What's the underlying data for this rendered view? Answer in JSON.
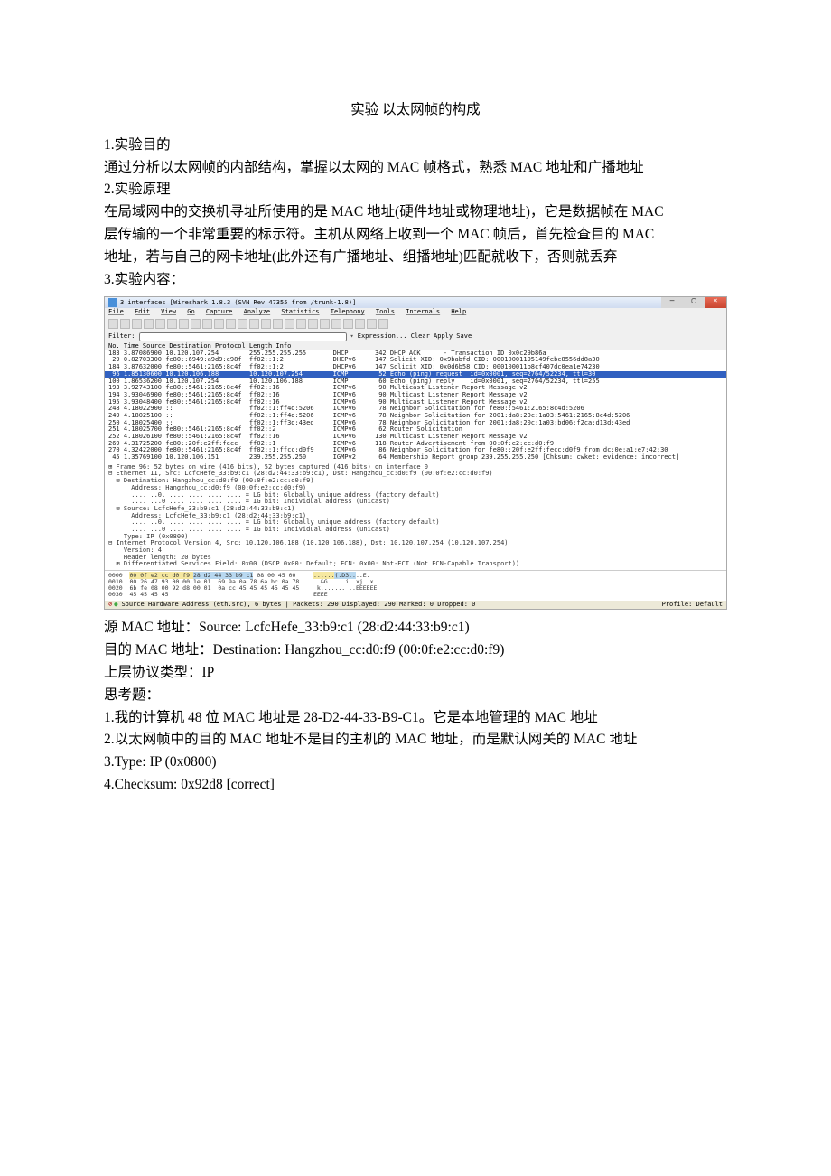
{
  "title": "实验 以太网帧的构成",
  "s1h": "1.实验目的",
  "s1": "通过分析以太网帧的内部结构，掌握以太网的 MAC 帧格式，熟悉 MAC 地址和广播地址",
  "s2h": "2.实验原理",
  "s2a": "在局域网中的交换机寻址所使用的是 MAC 地址(硬件地址或物理地址)，它是数据帧在 MAC",
  "s2b": "层传输的一个非常重要的标示符。主机从网络上收到一个 MAC 帧后，首先检查目的 MAC",
  "s2c": "地址，若与自己的网卡地址(此外还有广播地址、组播地址)匹配就收下，否则就丢弃",
  "s3h": "3.实验内容：",
  "ws": {
    "wtitle": "3 interfaces  [Wireshark 1.8.3  (SVN Rev 47355 from /trunk-1.8)]",
    "menu": [
      "File",
      "Edit",
      "View",
      "Go",
      "Capture",
      "Analyze",
      "Statistics",
      "Telephony",
      "Tools",
      "Internals",
      "Help"
    ],
    "filter_l": "Filter:",
    "filter_r": "Expression...  Clear  Apply  Save",
    "header": "No.   Time        Source                   Destination           Protocol  Length Info",
    "rows": [
      "183 3.87086900 10.120.107.254        255.255.255.255       DHCP       342 DHCP ACK      - Transaction ID 0x0c29b86a",
      " 29 0.82703300 fe80::6949:a9d9:e98f  ff02::1:2             DHCPv6     147 Solicit XID: 0x9babfd CID: 00010001195149febc8556dd8a30",
      "184 3.87632000 fe80::5461:2165:8c4f  ff02::1:2             DHCPv6     147 Solicit XID: 0x0d6b58 CID: 000100011b8cf407dc0ea1e74230",
      " 96 1.85130600 10.120.106.188        10.120.107.254        ICMP        52 Echo (ping) request  id=0x0001, seq=2764/52234, ttl=30",
      "100 1.86536200 10.120.107.254        10.120.106.188        ICMP        60 Echo (ping) reply    id=0x0001, seq=2764/52234, ttl=255",
      "193 3.92743100 fe80::5461:2165:8c4f  ff02::16              ICMPv6      90 Multicast Listener Report Message v2",
      "194 3.93046900 fe80::5461:2165:8c4f  ff02::16              ICMPv6      90 Multicast Listener Report Message v2",
      "195 3.93048400 fe80::5461:2165:8c4f  ff02::16              ICMPv6      90 Multicast Listener Report Message v2",
      "248 4.18022900 ::                    ff02::1:ff4d:5206     ICMPv6      78 Neighbor Solicitation for fe80::5461:2165:8c4d:5206",
      "249 4.18025100 ::                    ff02::1:ff4d:5206     ICMPv6      78 Neighbor Solicitation for 2001:da8:20c:1a03:5461:2165:8c4d:5206",
      "250 4.18025400 ::                    ff02::1:ff3d:43ed     ICMPv6      78 Neighbor Solicitation for 2001:da8:20c:1a03:bd06:f2ca:d13d:43ed",
      "251 4.18025700 fe80::5461:2165:8c4f  ff02::2               ICMPv6      62 Router Solicitation",
      "252 4.18026100 fe80::5461:2165:8c4f  ff02::16              ICMPv6     130 Multicast Listener Report Message v2",
      "269 4.31725200 fe80::20f:e2ff:fecc   ff02::1               ICMPv6     118 Router Advertisement from 00:0f:e2:cc:d0:f9",
      "270 4.32422000 fe80::5461:2165:8c4f  ff02::1:ffcc:d0f9     ICMPv6      86 Neighbor Solicitation for fe80::20f:e2ff:fecc:d0f9 from dc:0e:a1:e7:42:30",
      " 45 1.35769100 10.120.106.151        239.255.255.250       IGMPv2      64 Membership Report group 239.255.255.250 [Chksum: cwket: evidence: incorrect]"
    ],
    "hl_row": 3,
    "details": [
      "⊞ Frame 96: 52 bytes on wire (416 bits), 52 bytes captured (416 bits) on interface 0",
      "⊟ Ethernet II, Src: LcfcHefe_33:b9:c1 (28:d2:44:33:b9:c1), Dst: Hangzhou_cc:d0:f9 (00:0f:e2:cc:d0:f9)",
      "  ⊟ Destination: Hangzhou_cc:d0:f9 (00:0f:e2:cc:d0:f9)",
      "      Address: Hangzhou_cc:d0:f9 (00:0f:e2:cc:d0:f9)",
      "      .... ..0. .... .... .... .... = LG bit: Globally unique address (factory default)",
      "      .... ...0 .... .... .... .... = IG bit: Individual address (unicast)",
      "  ⊟ Source: LcfcHefe_33:b9:c1 (28:d2:44:33:b9:c1)",
      "      Address: LcfcHefe_33:b9:c1 (28:d2:44:33:b9:c1)",
      "      .... ..0. .... .... .... .... = LG bit: Globally unique address (factory default)",
      "      .... ...0 .... .... .... .... = IG bit: Individual address (unicast)",
      "    Type: IP (0x0800)",
      "⊟ Internet Protocol Version 4, Src: 10.120.106.188 (10.120.106.188), Dst: 10.120.107.254 (10.120.107.254)",
      "    Version: 4",
      "    Header length: 20 bytes",
      "  ⊞ Differentiated Services Field: 0x00 (DSCP 0x00: Default; ECN: 0x00: Not-ECT (Not ECN-Capable Transport))"
    ],
    "hex": [
      [
        "0000  ",
        "00 0f e2 cc d0 f9 ",
        "28 d2 44 33 b9 c1",
        " 08 00 45 00     ",
        "......",
        "(.D3..",
        "..E."
      ],
      [
        "0010  ",
        "00 26 47 93 00 00 1e 01  69 9a 0a 78 6a bc 0a 78     .&G.... i..xj..x",
        "",
        "",
        "",
        "",
        ""
      ],
      [
        "0020  ",
        "6b fe 08 00 92 d8 00 01  0a cc 45 45 45 45 45 45     k....... ..EEEEEE",
        "",
        "",
        "",
        "",
        ""
      ],
      [
        "0030  ",
        "45 45 45 45                                         EEEE",
        "",
        "",
        "",
        "",
        ""
      ]
    ],
    "status_l": "Source Hardware Address (eth.src), 6 bytes | Packets: 290 Displayed: 290 Marked: 0 Dropped: 0",
    "status_r": "Profile: Default"
  },
  "ans1": "源 MAC 地址：Source: LcfcHefe_33:b9:c1 (28:d2:44:33:b9:c1)",
  "ans2": "目的 MAC 地址：Destination: Hangzhou_cc:d0:f9 (00:0f:e2:cc:d0:f9)",
  "ans3": "上层协议类型：IP",
  "qh": "思考题：",
  "q1": "1.我的计算机 48 位 MAC 地址是 28-D2-44-33-B9-C1。它是本地管理的 MAC 地址",
  "q2": "2.以太网帧中的目的 MAC 地址不是目的主机的 MAC 地址，而是默认网关的 MAC 地址",
  "q3": "3.Type: IP (0x0800)",
  "q4": "4.Checksum: 0x92d8 [correct]"
}
